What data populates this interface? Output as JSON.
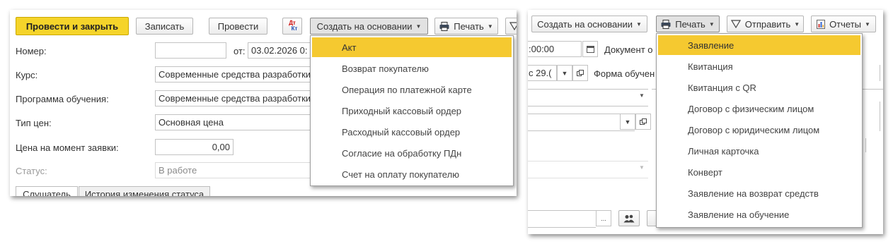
{
  "left": {
    "toolbar": {
      "post_close": "Провести и закрыть",
      "save": "Записать",
      "post": "Провести",
      "dtkt_top": "Дт",
      "dtkt_bottom": "Кт",
      "create_basis": "Создать на основании",
      "print": "Печать"
    },
    "form": {
      "number_label": "Номер:",
      "number_value": "",
      "date_from_label": "от:",
      "date_value": "03.02.2026  0:",
      "course_label": "Курс:",
      "course_value": "Современные средства разработки",
      "program_label": "Программа обучения:",
      "program_value": "Современные средства разработки",
      "price_type_label": "Тип цен:",
      "price_type_value": "Основная цена",
      "price_label": "Цена на момент заявки:",
      "price_value": "0,00",
      "status_label": "Статус:",
      "status_value": "В работе"
    },
    "tabs": [
      "Слушатель",
      "История изменения статуса"
    ],
    "create_menu": {
      "items": [
        "Акт",
        "Возврат покупателю",
        "Операция по платежной карте",
        "Приходный кассовый ордер",
        "Расходный кассовый ордер",
        "Согласие на обработку ПДн",
        "Счет на оплату покупателю"
      ],
      "highlighted_index": 0
    }
  },
  "right": {
    "toolbar": {
      "create_basis": "Создать на основании",
      "print": "Печать",
      "send": "Отправить",
      "reports": "Отчеты"
    },
    "form": {
      "time_value": ":00:00",
      "document_label": "Документ о",
      "from_date_value": "с 29.(",
      "education_form_label": "Форма обучен"
    },
    "print_menu": {
      "items": [
        "Заявление",
        "Квитанция",
        "Квитанция с QR",
        "Договор с физическим лицом",
        "Договор с юридическим лицом",
        "Личная карточка",
        "Конверт",
        "Заявление на возврат средств",
        "Заявление на обучение"
      ],
      "highlighted_index": 0
    }
  },
  "colors": {
    "accent_yellow": "#f5d42a",
    "menu_highlight": "#f5c930",
    "dt_red": "#cc0000",
    "kt_blue": "#1f4fb4"
  }
}
